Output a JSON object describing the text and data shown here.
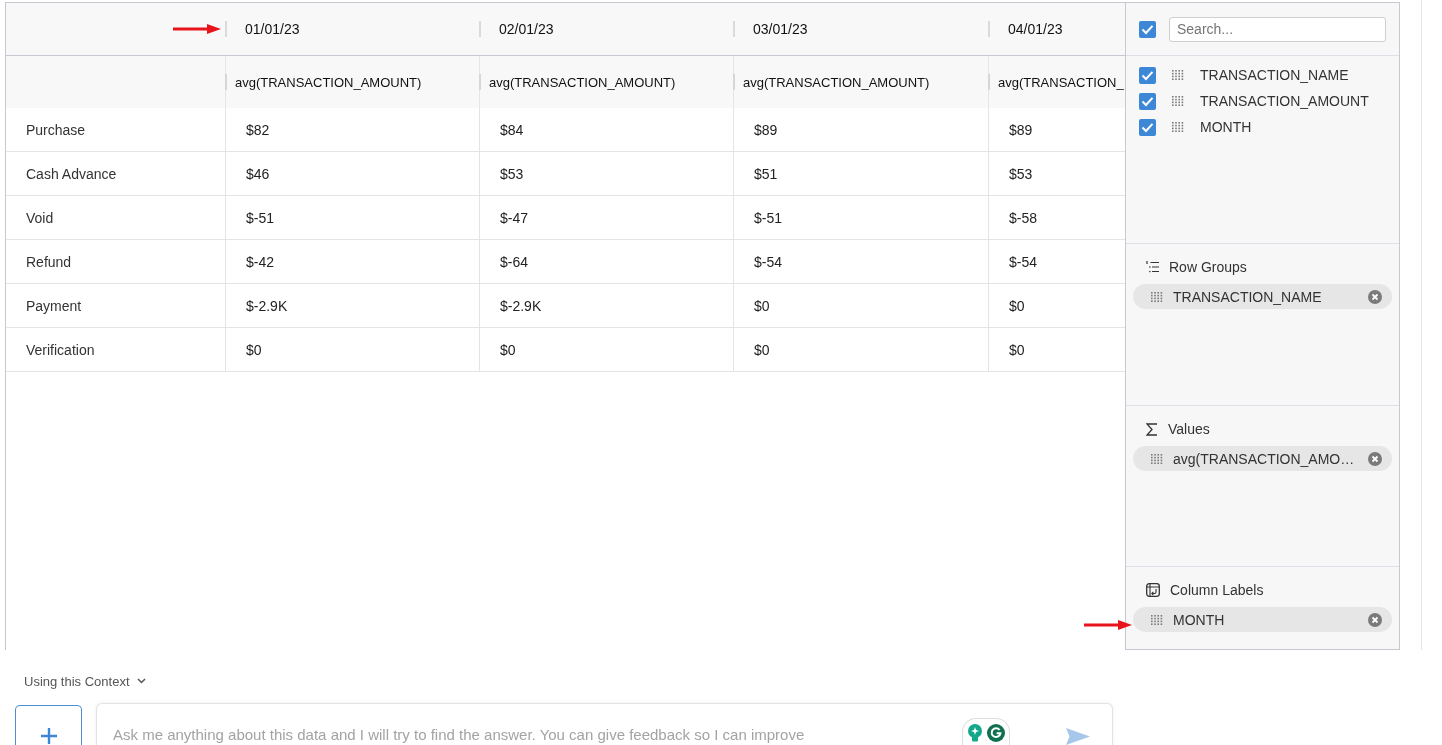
{
  "pivot_table": {
    "date_headers": [
      {
        "label": "01/01/23",
        "arrow_marker": true
      },
      {
        "label": "02/01/23",
        "arrow_marker": false
      },
      {
        "label": "03/01/23",
        "arrow_marker": false
      },
      {
        "label": "04/01/23",
        "arrow_marker": false
      }
    ],
    "value_headers": [
      "avg(TRANSACTION_AMOUNT)",
      "avg(TRANSACTION_AMOUNT)",
      "avg(TRANSACTION_AMOUNT)",
      "avg(TRANSACTION_"
    ],
    "rows": [
      {
        "label": "Purchase",
        "cells": [
          "$82",
          "$84",
          "$89",
          "$89"
        ]
      },
      {
        "label": "Cash Advance",
        "cells": [
          "$46",
          "$53",
          "$51",
          "$53"
        ]
      },
      {
        "label": "Void",
        "cells": [
          "$-51",
          "$-47",
          "$-51",
          "$-58"
        ]
      },
      {
        "label": "Refund",
        "cells": [
          "$-42",
          "$-64",
          "$-54",
          "$-54"
        ]
      },
      {
        "label": "Payment",
        "cells": [
          "$-2.9K",
          "$-2.9K",
          "$0",
          "$0"
        ]
      },
      {
        "label": "Verification",
        "cells": [
          "$0",
          "$0",
          "$0",
          "$0"
        ]
      }
    ]
  },
  "side_panel": {
    "select_all": {
      "checked": true
    },
    "search": {
      "placeholder": "Search..."
    },
    "columns": [
      {
        "label": "TRANSACTION_NAME",
        "checked": true
      },
      {
        "label": "TRANSACTION_AMOUNT",
        "checked": true
      },
      {
        "label": "MONTH",
        "checked": true
      }
    ],
    "sections": [
      {
        "kind": "row_groups",
        "title": "Row Groups",
        "chips": [
          {
            "label": "TRANSACTION_NAME",
            "arrow_marker": false
          }
        ]
      },
      {
        "kind": "values",
        "title": "Values",
        "chips": [
          {
            "label": "avg(TRANSACTION_AMO…",
            "arrow_marker": false
          }
        ]
      },
      {
        "kind": "column_labels",
        "title": "Column Labels",
        "chips": [
          {
            "label": "MONTH",
            "arrow_marker": true
          }
        ]
      }
    ]
  },
  "chat": {
    "context_selector": "Using this Context",
    "input": {
      "placeholder": "Ask me anything about this data and I will try to find the answer. You can give feedback so I can improve"
    }
  }
}
